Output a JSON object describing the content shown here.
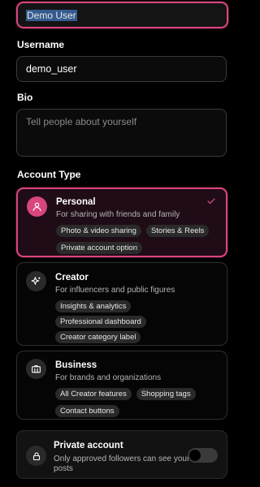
{
  "profile": {
    "display_name": "Demo User",
    "username_label": "Username",
    "username_value": "demo_user",
    "bio_label": "Bio",
    "bio_placeholder": "Tell people about yourself"
  },
  "account_type": {
    "label": "Account Type",
    "options": [
      {
        "title": "Personal",
        "subtitle": "For sharing with friends and family",
        "icon": "user-icon",
        "selected": true,
        "tags": [
          "Photo & video sharing",
          "Stories & Reels",
          "Private account option"
        ]
      },
      {
        "title": "Creator",
        "subtitle": "For influencers and public figures",
        "icon": "sparkle-icon",
        "selected": false,
        "tags": [
          "Insights & analytics",
          "Professional dashboard",
          "Creator category label"
        ]
      },
      {
        "title": "Business",
        "subtitle": "For brands and organizations",
        "icon": "briefcase-icon",
        "selected": false,
        "tags": [
          "All Creator features",
          "Shopping tags",
          "Contact buttons"
        ]
      }
    ]
  },
  "private_account": {
    "title": "Private account",
    "description": "Only approved followers can see your posts",
    "icon": "lock-icon",
    "enabled": false
  },
  "colors": {
    "accent": "#d9457f",
    "background": "#000000"
  }
}
